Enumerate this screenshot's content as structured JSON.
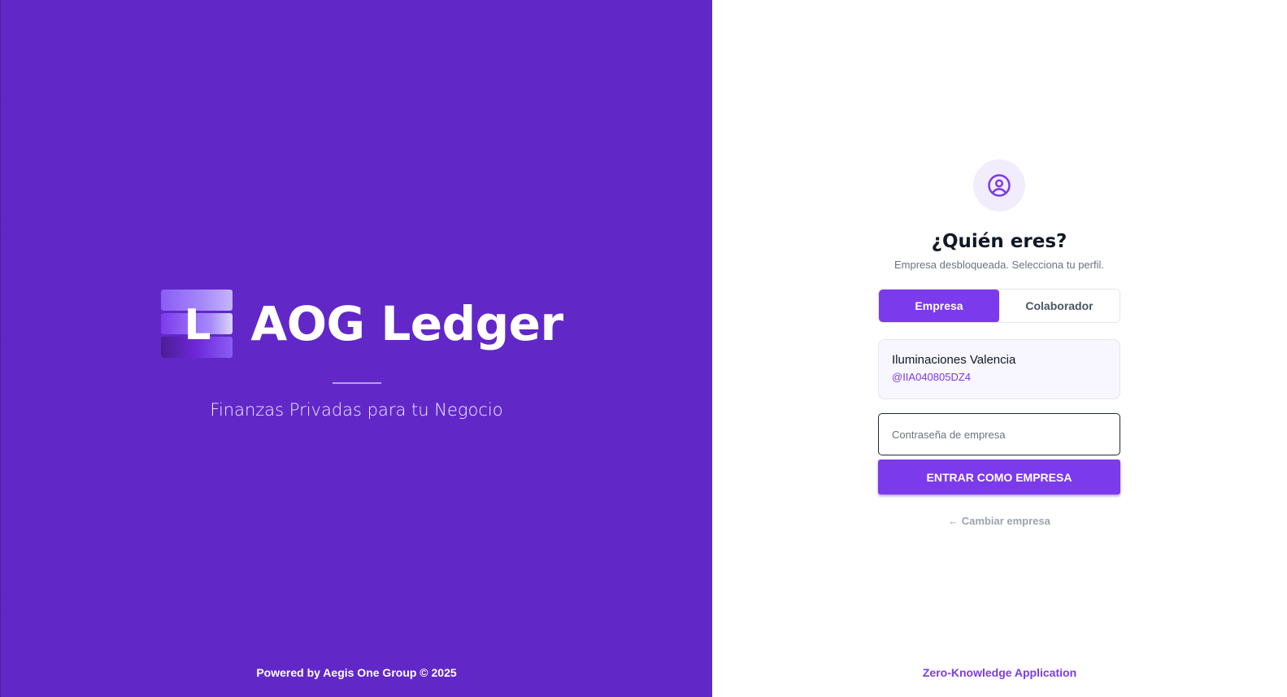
{
  "brand": {
    "logo_letter": "L",
    "app_name": "AOG Ledger",
    "tagline": "Finanzas Privadas para tu Negocio",
    "footer": "Powered by Aegis One Group © 2025",
    "background_color": "#6128c7"
  },
  "login": {
    "avatar_icon": "user-circle-icon",
    "title": "¿Quién eres?",
    "subtitle": "Empresa desbloqueada. Selecciona tu perfil.",
    "tabs": [
      {
        "label": "Empresa",
        "active": true
      },
      {
        "label": "Colaborador",
        "active": false
      }
    ],
    "company": {
      "name": "Iluminaciones Valencia",
      "handle": "@IIA040805DZ4"
    },
    "password_placeholder": "Contraseña de empresa",
    "password_value": "",
    "submit_label": "ENTRAR COMO EMPRESA",
    "change_link": "← Cambiar empresa",
    "footer": "Zero-Knowledge Application",
    "accent_color": "#7c3aed"
  }
}
